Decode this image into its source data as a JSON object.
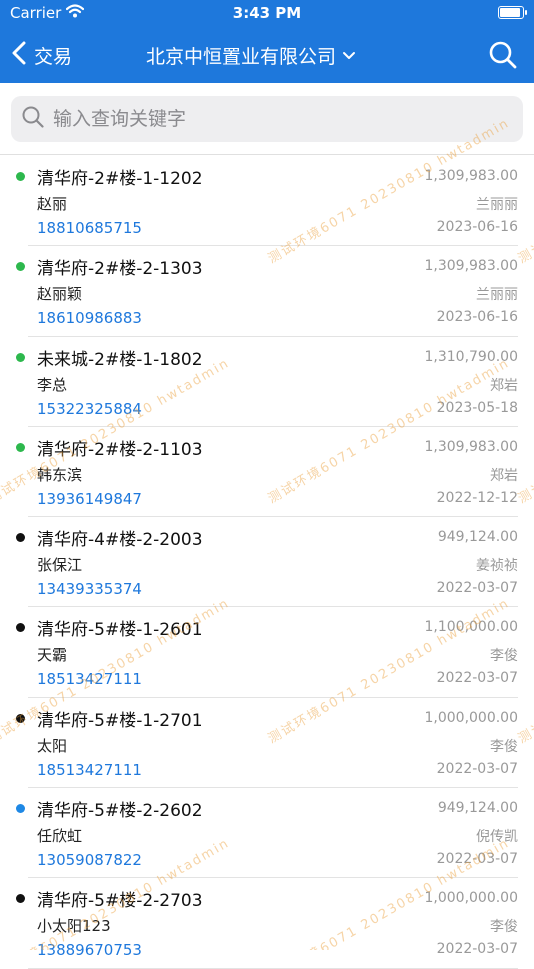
{
  "status_bar": {
    "carrier": "Carrier",
    "time": "3:43 PM"
  },
  "nav": {
    "back_label": "交易",
    "title": "北京中恒置业有限公司"
  },
  "search": {
    "placeholder": "输入查询关键字",
    "value": ""
  },
  "colors": {
    "accent": "#1e78dc",
    "dot_green": "#2db84d",
    "dot_black": "#111111",
    "dot_blue": "#1e88e5"
  },
  "watermark": "测试环境6071 20230810 hwtadmin",
  "transactions": [
    {
      "unit": "清华府-2#楼-1-1202",
      "price": "1,309,983.00",
      "customer": "赵丽",
      "agent": "兰丽丽",
      "phone": "18810685715",
      "date": "2023-06-16",
      "status_color": "#2db84d"
    },
    {
      "unit": "清华府-2#楼-2-1303",
      "price": "1,309,983.00",
      "customer": "赵丽颖",
      "agent": "兰丽丽",
      "phone": "18610986883",
      "date": "2023-06-16",
      "status_color": "#2db84d"
    },
    {
      "unit": "未来城-2#楼-1-1802",
      "price": "1,310,790.00",
      "customer": "李总",
      "agent": "郑岩",
      "phone": "15322325884",
      "date": "2023-05-18",
      "status_color": "#2db84d"
    },
    {
      "unit": "清华府-2#楼-2-1103",
      "price": "1,309,983.00",
      "customer": "韩东滨",
      "agent": "郑岩",
      "phone": "13936149847",
      "date": "2022-12-12",
      "status_color": "#2db84d"
    },
    {
      "unit": "清华府-4#楼-2-2003",
      "price": "949,124.00",
      "customer": "张保江",
      "agent": "姜祯祯",
      "phone": "13439335374",
      "date": "2022-03-07",
      "status_color": "#111111"
    },
    {
      "unit": "清华府-5#楼-1-2601",
      "price": "1,100,000.00",
      "customer": "天霸",
      "agent": "李俊",
      "phone": "18513427111",
      "date": "2022-03-07",
      "status_color": "#111111"
    },
    {
      "unit": "清华府-5#楼-1-2701",
      "price": "1,000,000.00",
      "customer": "太阳",
      "agent": "李俊",
      "phone": "18513427111",
      "date": "2022-03-07",
      "status_color": "#111111"
    },
    {
      "unit": "清华府-5#楼-2-2602",
      "price": "949,124.00",
      "customer": "任欣虹",
      "agent": "倪传凯",
      "phone": "13059087822",
      "date": "2022-03-07",
      "status_color": "#1e88e5"
    },
    {
      "unit": "清华府-5#楼-2-2703",
      "price": "1,000,000.00",
      "customer": "小太阳123",
      "agent": "李俊",
      "phone": "13889670753",
      "date": "2022-03-07",
      "status_color": "#111111"
    }
  ]
}
